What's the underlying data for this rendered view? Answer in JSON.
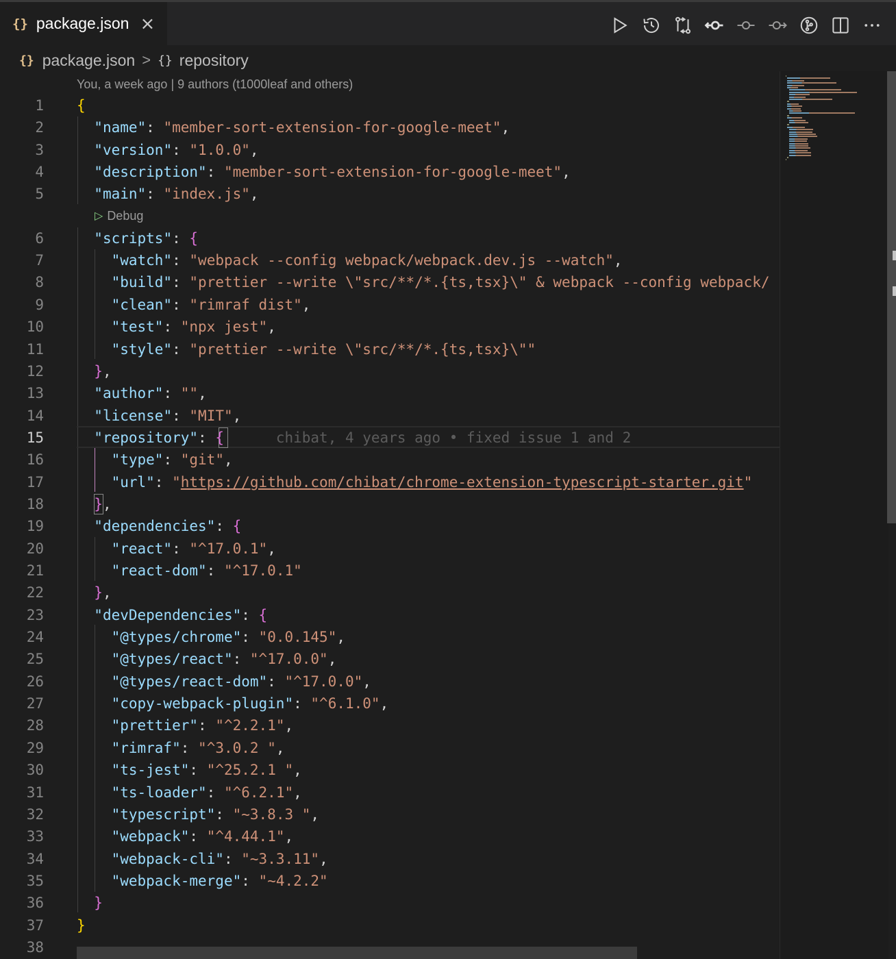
{
  "tab": {
    "icon": "{}",
    "label": "package.json",
    "close": "×"
  },
  "toolbar": {
    "actions": [
      "run-icon",
      "history-icon",
      "compare-changes-icon",
      "git-commit-previous-icon",
      "git-commit-icon",
      "git-commit-next-icon",
      "gitlens-icon",
      "split-editor-icon",
      "more-actions-icon"
    ]
  },
  "breadcrumb": {
    "file_icon": "{}",
    "file": "package.json",
    "separator": ">",
    "node_icon": "{}",
    "node": "repository"
  },
  "codelens": {
    "authors": "You, a week ago | 9 authors (t1000leaf and others)",
    "debug": "Debug"
  },
  "blame": "chibat, 4 years ago • fixed issue 1 and 2",
  "current_line": 15,
  "colors": {
    "key": "#9cdcfe",
    "string": "#ce9178",
    "bracket1": "#ffd700",
    "bracket2": "#da70d6"
  },
  "lines": [
    {
      "n": "1",
      "t": "{"
    },
    {
      "n": "2",
      "t": "  \"name\": \"member-sort-extension-for-google-meet\","
    },
    {
      "n": "3",
      "t": "  \"version\": \"1.0.0\","
    },
    {
      "n": "4",
      "t": "  \"description\": \"member-sort-extension-for-google-meet\","
    },
    {
      "n": "5",
      "t": "  \"main\": \"index.js\","
    },
    {
      "n": "6",
      "t": "  \"scripts\": {"
    },
    {
      "n": "7",
      "t": "    \"watch\": \"webpack --config webpack/webpack.dev.js --watch\","
    },
    {
      "n": "8",
      "t": "    \"build\": \"prettier --write \\\"src/**/*.{ts,tsx}\\\" & webpack --config webpack/"
    },
    {
      "n": "9",
      "t": "    \"clean\": \"rimraf dist\","
    },
    {
      "n": "10",
      "t": "    \"test\": \"npx jest\","
    },
    {
      "n": "11",
      "t": "    \"style\": \"prettier --write \\\"src/**/*.{ts,tsx}\\\"\""
    },
    {
      "n": "12",
      "t": "  },"
    },
    {
      "n": "13",
      "t": "  \"author\": \"\","
    },
    {
      "n": "14",
      "t": "  \"license\": \"MIT\","
    },
    {
      "n": "15",
      "t": "  \"repository\": {"
    },
    {
      "n": "16",
      "t": "    \"type\": \"git\","
    },
    {
      "n": "17",
      "t": "    \"url\": \"https://github.com/chibat/chrome-extension-typescript-starter.git\""
    },
    {
      "n": "18",
      "t": "  },"
    },
    {
      "n": "19",
      "t": "  \"dependencies\": {"
    },
    {
      "n": "20",
      "t": "    \"react\": \"^17.0.1\","
    },
    {
      "n": "21",
      "t": "    \"react-dom\": \"^17.0.1\""
    },
    {
      "n": "22",
      "t": "  },"
    },
    {
      "n": "23",
      "t": "  \"devDependencies\": {"
    },
    {
      "n": "24",
      "t": "    \"@types/chrome\": \"0.0.145\","
    },
    {
      "n": "25",
      "t": "    \"@types/react\": \"^17.0.0\","
    },
    {
      "n": "26",
      "t": "    \"@types/react-dom\": \"^17.0.0\","
    },
    {
      "n": "27",
      "t": "    \"copy-webpack-plugin\": \"^6.1.0\","
    },
    {
      "n": "28",
      "t": "    \"prettier\": \"^2.2.1\","
    },
    {
      "n": "29",
      "t": "    \"rimraf\": \"^3.0.2 \","
    },
    {
      "n": "30",
      "t": "    \"ts-jest\": \"^25.2.1 \","
    },
    {
      "n": "31",
      "t": "    \"ts-loader\": \"^6.2.1\","
    },
    {
      "n": "32",
      "t": "    \"typescript\": \"~3.8.3 \","
    },
    {
      "n": "33",
      "t": "    \"webpack\": \"^4.44.1\","
    },
    {
      "n": "34",
      "t": "    \"webpack-cli\": \"~3.3.11\","
    },
    {
      "n": "35",
      "t": "    \"webpack-merge\": \"~4.2.2\""
    },
    {
      "n": "36",
      "t": "  }"
    },
    {
      "n": "37",
      "t": "}"
    },
    {
      "n": "38",
      "t": ""
    }
  ]
}
